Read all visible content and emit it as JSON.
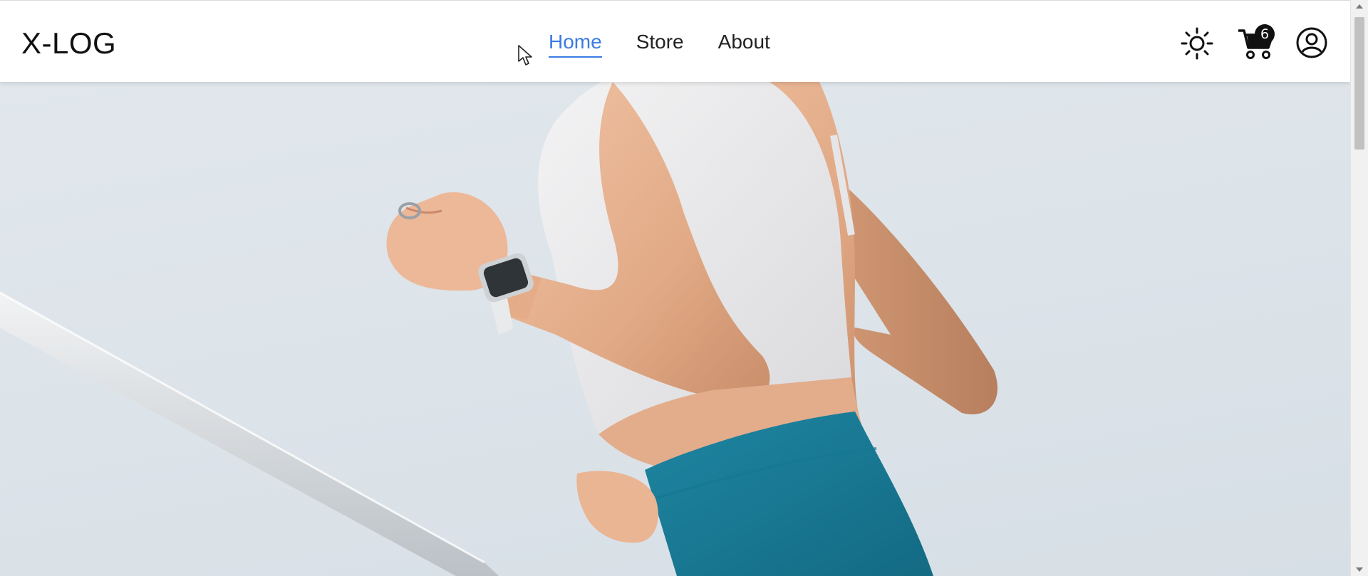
{
  "navbar": {
    "brand": "X-LOG",
    "links": [
      {
        "label": "Home",
        "active": true
      },
      {
        "label": "Store",
        "active": false
      },
      {
        "label": "About",
        "active": false
      }
    ],
    "icons": {
      "theme": "sun-icon",
      "cart": "cart-icon",
      "user": "user-circle-icon"
    },
    "cart_count": "6"
  },
  "hero": {
    "image": "woman running in white sports bra and teal leggings wearing a smartwatch"
  },
  "colors": {
    "accent": "#3b7be3",
    "text": "#111111",
    "sky": "#dfe6ec",
    "leggings": "#1c7a95"
  }
}
